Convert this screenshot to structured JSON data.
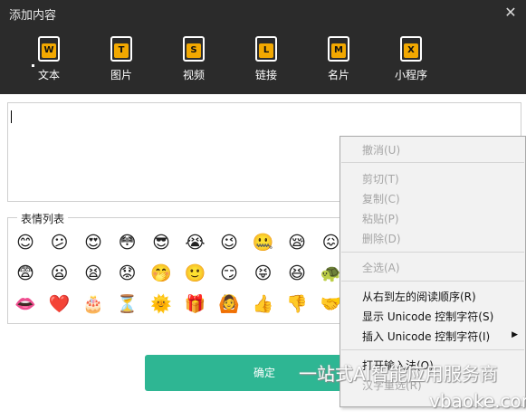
{
  "window": {
    "title": "添加内容",
    "close_label": "✕"
  },
  "toolbar": {
    "items": [
      {
        "letter": "W",
        "label": "文本",
        "icon": "text-icon"
      },
      {
        "letter": "T",
        "label": "图片",
        "icon": "image-icon"
      },
      {
        "letter": "S",
        "label": "视频",
        "icon": "video-icon"
      },
      {
        "letter": "L",
        "label": "链接",
        "icon": "link-icon"
      },
      {
        "letter": "M",
        "label": "名片",
        "icon": "card-icon"
      },
      {
        "letter": "X",
        "label": "小程序",
        "icon": "miniprogram-icon"
      }
    ]
  },
  "emoji_panel": {
    "title": "表情列表",
    "emojis": [
      "😊",
      "😕",
      "😍",
      "😳",
      "😎",
      "😭",
      "😉",
      "🤐",
      "😪",
      "😖",
      "😨",
      "😦",
      "😫",
      "😟",
      "🤭",
      "🙂",
      "😏",
      "😝",
      "😆",
      "🐢",
      "👄",
      "❤️",
      "🎂",
      "⏳",
      "🌞",
      "🎁",
      "🙆",
      "👍",
      "👎",
      "🤝"
    ]
  },
  "confirm_label": "确定",
  "context_menu": {
    "undo": "撤消(U)",
    "cut": "剪切(T)",
    "copy": "复制(C)",
    "paste": "粘贴(P)",
    "delete": "删除(D)",
    "select_all": "全选(A)",
    "rtl": "从右到左的阅读顺序(R)",
    "show_unicode": "显示 Unicode 控制字符(S)",
    "insert_unicode": "插入 Unicode 控制字符(I)",
    "open_ime": "打开输入法(O)",
    "reconvert": "汉字重选(R)",
    "submenu_arrow": "▶"
  },
  "watermark": {
    "line1": "一站式AI智能应用服务商",
    "line2": "vbaoke.com"
  },
  "colors": {
    "titlebar": "#2b2b2b",
    "badge": "#f2a800",
    "confirm": "#2eb693"
  }
}
